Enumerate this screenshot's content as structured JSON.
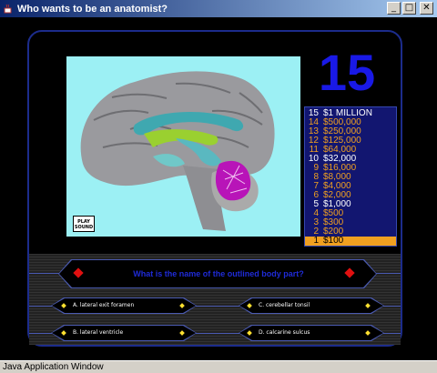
{
  "window": {
    "title": "Who wants to be an anatomist?",
    "minimize": "_",
    "maximize": "□",
    "close": "✕",
    "status": "Java Application Window"
  },
  "game": {
    "question_number": "15",
    "play_button": "PLAY SOUND",
    "question": "What is the name of the outlined body part?",
    "answers": [
      {
        "label": "A. lateral exit foramen"
      },
      {
        "label": "C. cerebellar tonsil"
      },
      {
        "label": "B. lateral ventricle"
      },
      {
        "label": "D. calcarine sulcus"
      }
    ],
    "ladder": [
      {
        "num": "15",
        "amount": "$1 MILLION",
        "state": "milestone"
      },
      {
        "num": "14",
        "amount": "$500,000",
        "state": "normal"
      },
      {
        "num": "13",
        "amount": "$250,000",
        "state": "normal"
      },
      {
        "num": "12",
        "amount": "$125,000",
        "state": "normal"
      },
      {
        "num": "11",
        "amount": "$64,000",
        "state": "normal"
      },
      {
        "num": "10",
        "amount": "$32,000",
        "state": "milestone"
      },
      {
        "num": "9",
        "amount": "$16,000",
        "state": "normal"
      },
      {
        "num": "8",
        "amount": "$8,000",
        "state": "normal"
      },
      {
        "num": "7",
        "amount": "$4,000",
        "state": "normal"
      },
      {
        "num": "6",
        "amount": "$2,000",
        "state": "normal"
      },
      {
        "num": "5",
        "amount": "$1,000",
        "state": "milestone"
      },
      {
        "num": "4",
        "amount": "$500",
        "state": "normal"
      },
      {
        "num": "3",
        "amount": "$300",
        "state": "normal"
      },
      {
        "num": "2",
        "amount": "$200",
        "state": "normal"
      },
      {
        "num": "1",
        "amount": "$100",
        "state": "current"
      }
    ]
  },
  "colors": {
    "ladder_bg": "#121670",
    "ladder_text": "#f0a020",
    "milestone_text": "#ffffff",
    "current_highlight": "#f0a020",
    "question_text": "#1f2bd8",
    "big_number": "#1919e6"
  }
}
